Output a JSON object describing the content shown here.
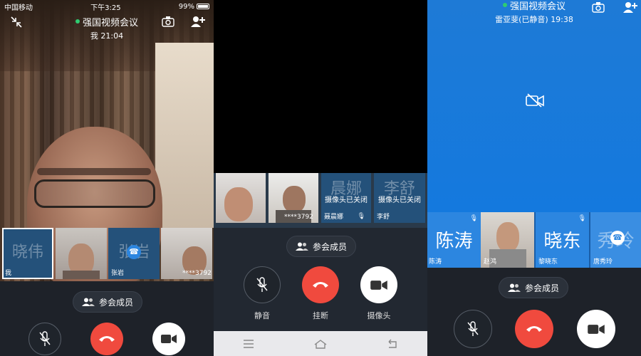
{
  "panel1": {
    "status": {
      "carrier": "中国移动",
      "time": "下午3:25",
      "battery": "99%"
    },
    "title": "强国视频会议",
    "subtitle": "我  21:04",
    "thumbnails": [
      {
        "label": "我",
        "avatar_text": "晓伟",
        "type": "text"
      },
      {
        "label": "",
        "avatar_text": "",
        "type": "video"
      },
      {
        "label": "张岩",
        "avatar_text": "张岩",
        "type": "text"
      },
      {
        "label": "****3792",
        "avatar_text": "",
        "type": "video"
      }
    ],
    "members_label": "参会成员"
  },
  "panel2": {
    "thumbnails": [
      {
        "label": "",
        "avatar_text": "",
        "overlay": "",
        "type": "video"
      },
      {
        "label": "****3792",
        "avatar_text": "",
        "overlay": "",
        "type": "video"
      },
      {
        "label": "聂晨娜",
        "avatar_text": "晨娜",
        "overlay": "摄像头已关闭",
        "type": "text"
      },
      {
        "label": "李舒",
        "avatar_text": "李舒",
        "overlay": "摄像头已关闭",
        "type": "text"
      }
    ],
    "members_label": "参会成员",
    "mute_label": "静音",
    "hangup_label": "挂断",
    "camera_label": "摄像头"
  },
  "panel3": {
    "title": "强国视频会议",
    "subtitle": "雷亚斐(已静音) 19:38",
    "thumbnails": [
      {
        "label": "陈涛",
        "avatar_text": "陈涛",
        "type": "text"
      },
      {
        "label": "赵鸿",
        "avatar_text": "",
        "type": "video"
      },
      {
        "label": "黎晓东",
        "avatar_text": "晓东",
        "type": "text"
      },
      {
        "label": "唐秀玲",
        "avatar_text": "秀玲",
        "type": "text"
      }
    ],
    "members_label": "参会成员"
  },
  "colors": {
    "hangup_red": "#f04a3e",
    "accent_blue": "#1479de",
    "online_green": "#2ecc71"
  },
  "icons": [
    "signal-icon",
    "wifi-icon",
    "battery-icon",
    "collapse-icon",
    "camera-switch-icon",
    "add-user-icon",
    "members-icon",
    "mic-muted-icon",
    "hangup-icon",
    "video-camera-icon",
    "camera-off-icon",
    "menu-icon",
    "home-icon",
    "back-icon",
    "muted-mic-badge-icon",
    "phone-badge-icon"
  ]
}
